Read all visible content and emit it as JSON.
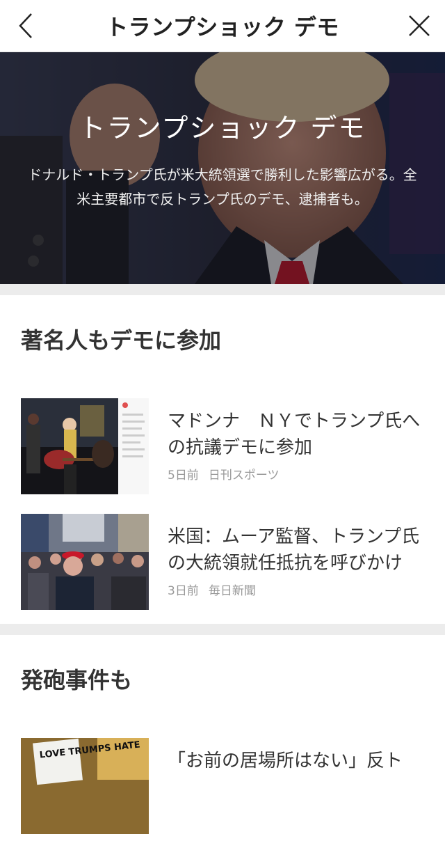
{
  "header": {
    "title": "トランプショック デモ"
  },
  "hero": {
    "title": "トランプショック デモ",
    "description": "ドナルド・トランプ氏が米大統領選で勝利した影響広がる。全米主要都市で反トランプ氏のデモ、逮捕者も。"
  },
  "sections": [
    {
      "title": "著名人もデモに参加",
      "articles": [
        {
          "title": "マドンナ　ＮＹでトランプ氏への抗議デモに参加",
          "time": "5日前",
          "source": "日刊スポーツ"
        },
        {
          "title": "米国：ムーア監督、トランプ氏の大統領就任抵抗を呼びかけ",
          "time": "3日前",
          "source": "毎日新聞"
        }
      ]
    },
    {
      "title": "発砲事件も",
      "articles": [
        {
          "title": "「お前の居場所はない」反ト",
          "sign_text": "LOVE TRUMPS HATE"
        }
      ]
    }
  ],
  "colors": {
    "accent_tie": "#c8182a",
    "divider": "#ececec",
    "meta": "#999999"
  }
}
